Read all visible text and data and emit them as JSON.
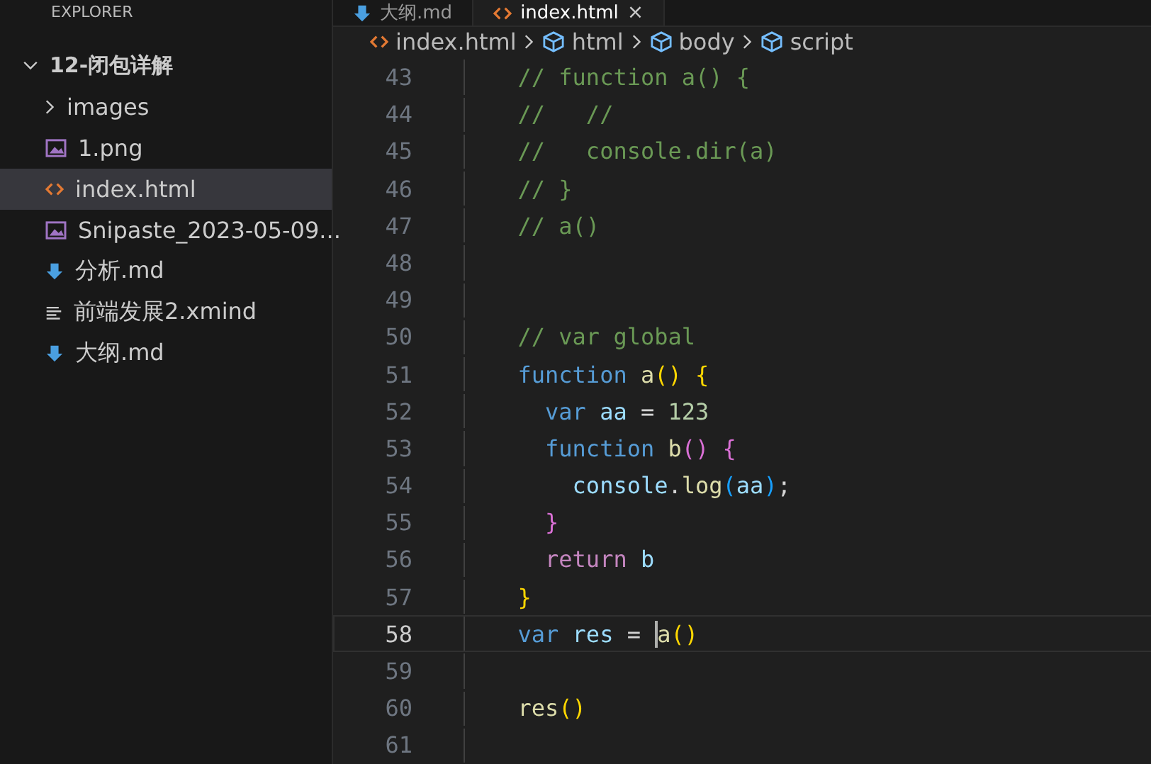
{
  "sidebar": {
    "header": "EXPLORER",
    "tree": [
      {
        "label": "12-闭包详解",
        "kind": "folder",
        "expanded": true,
        "selected": false,
        "children": [
          {
            "label": "images",
            "kind": "folder",
            "expanded": false,
            "selected": false
          },
          {
            "label": "1.png",
            "kind": "image",
            "selected": false
          },
          {
            "label": "index.html",
            "kind": "html",
            "selected": true
          },
          {
            "label": "Snipaste_2023-05-09...",
            "kind": "image",
            "selected": false
          },
          {
            "label": "分析.md",
            "kind": "markdown",
            "selected": false
          },
          {
            "label": "前端发展2.xmind",
            "kind": "text",
            "selected": false
          },
          {
            "label": "大纲.md",
            "kind": "markdown",
            "selected": false
          }
        ]
      }
    ]
  },
  "tabs": [
    {
      "label": "大纲.md",
      "kind": "markdown",
      "selected": false
    },
    {
      "label": "index.html",
      "kind": "html",
      "selected": true,
      "close": "×"
    }
  ],
  "breadcrumb": [
    {
      "label": "index.html",
      "kind": "html"
    },
    {
      "label": "html",
      "kind": "element"
    },
    {
      "label": "body",
      "kind": "element"
    },
    {
      "label": "script",
      "kind": "element"
    }
  ],
  "editor": {
    "lines": [
      {
        "number": "43",
        "current": false,
        "tokens": [
          {
            "kind": "comment",
            "text": "  // function a() {"
          }
        ]
      },
      {
        "number": "44",
        "current": false,
        "tokens": [
          {
            "kind": "comment",
            "text": "  //   //"
          }
        ]
      },
      {
        "number": "45",
        "current": false,
        "tokens": [
          {
            "kind": "comment",
            "text": "  //   console.dir(a)"
          }
        ]
      },
      {
        "number": "46",
        "current": false,
        "tokens": [
          {
            "kind": "comment",
            "text": "  // }"
          }
        ]
      },
      {
        "number": "47",
        "current": false,
        "tokens": [
          {
            "kind": "comment",
            "text": "  // a()"
          }
        ]
      },
      {
        "number": "48",
        "current": false
      },
      {
        "number": "49",
        "current": false
      },
      {
        "number": "50",
        "current": false,
        "tokens": [
          {
            "kind": "comment",
            "text": "  // var global"
          }
        ]
      },
      {
        "number": "51",
        "current": false,
        "tokens": [
          {
            "kind": "keyword",
            "text": "  function "
          },
          {
            "kind": "func",
            "text": "a"
          },
          {
            "kind": "bracket1",
            "text": "() {"
          }
        ]
      },
      {
        "number": "52",
        "current": false,
        "tokens": [
          {
            "kind": "keyword",
            "text": "    var "
          },
          {
            "kind": "variable",
            "text": "aa"
          },
          {
            "kind": "plain",
            "text": " = "
          },
          {
            "kind": "number",
            "text": "123"
          }
        ]
      },
      {
        "number": "53",
        "current": false,
        "tokens": [
          {
            "kind": "keyword",
            "text": "    function "
          },
          {
            "kind": "func",
            "text": "b"
          },
          {
            "kind": "bracket2",
            "text": "() {"
          }
        ]
      },
      {
        "number": "54",
        "current": false,
        "tokens": [
          {
            "kind": "variable",
            "text": "      console"
          },
          {
            "kind": "plain",
            "text": "."
          },
          {
            "kind": "func",
            "text": "log"
          },
          {
            "kind": "bracket3",
            "text": "("
          },
          {
            "kind": "variable",
            "text": "aa"
          },
          {
            "kind": "bracket3",
            "text": ")"
          },
          {
            "kind": "plain",
            "text": ";"
          }
        ]
      },
      {
        "number": "55",
        "current": false,
        "tokens": [
          {
            "kind": "bracket2",
            "text": "    }"
          }
        ]
      },
      {
        "number": "56",
        "current": false,
        "tokens": [
          {
            "kind": "control",
            "text": "    return "
          },
          {
            "kind": "variable",
            "text": "b"
          }
        ]
      },
      {
        "number": "57",
        "current": false,
        "tokens": [
          {
            "kind": "bracket1",
            "text": "  }"
          }
        ]
      },
      {
        "number": "58",
        "current": true,
        "tokens": [
          {
            "kind": "keyword",
            "text": "  var "
          },
          {
            "kind": "variable",
            "text": "res"
          },
          {
            "kind": "plain",
            "text": " = "
          },
          {
            "kind": "cursor"
          },
          {
            "kind": "func",
            "text": "a"
          },
          {
            "kind": "bracket1",
            "text": "()"
          }
        ]
      },
      {
        "number": "59",
        "current": false
      },
      {
        "number": "60",
        "current": false,
        "tokens": [
          {
            "kind": "func",
            "text": "  res"
          },
          {
            "kind": "bracket1",
            "text": "()"
          }
        ]
      },
      {
        "number": "61",
        "current": false
      }
    ]
  }
}
